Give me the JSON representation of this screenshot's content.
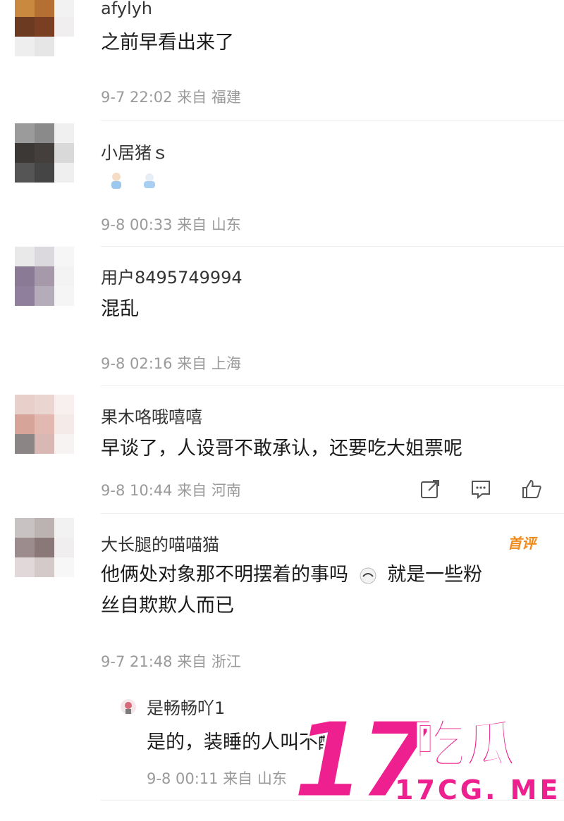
{
  "comments": [
    {
      "username": "afylyh",
      "text": "之前早看出来了",
      "time": "9-7 22:02",
      "from_label": "来自",
      "location": "福建",
      "avatar_colors": [
        "#c98a3f",
        "#b56f33",
        "#f2f2f2",
        "#6b3a20",
        "#7a3f22",
        "#f0eeee",
        "#eeeeee",
        "#e6e6e6",
        "#ffffff"
      ]
    },
    {
      "username": "小居猪ｓ",
      "text": "",
      "emoji": [
        "baby-emoji-icon",
        "baby-emoji-icon"
      ],
      "time": "9-8 00:33",
      "from_label": "来自",
      "location": "山东",
      "avatar_colors": [
        "#9b9b9b",
        "#8a8a8a",
        "#f0f0f0",
        "#3c3835",
        "#443f3c",
        "#d9d9d9",
        "#555555",
        "#454545",
        "#efefef"
      ]
    },
    {
      "username": "用户8495749994",
      "text": "混乱",
      "time": "9-8 02:16",
      "from_label": "来自",
      "location": "上海",
      "avatar_colors": [
        "#e9e9ea",
        "#dcd9de",
        "#f6f6f6",
        "#8a7a96",
        "#a69aaa",
        "#f3f3f3",
        "#8f7f9c",
        "#b5acb9",
        "#f5f5f5"
      ]
    },
    {
      "username": "果木咯哦嘻嘻",
      "text": "早谈了，人设哥不敢承认，还要吃大姐票呢",
      "time": "9-8 10:44",
      "from_label": "来自",
      "location": "河南",
      "avatar_colors": [
        "#e8cfc9",
        "#ead5d1",
        "#f8f0ef",
        "#d7a49a",
        "#e2b9b0",
        "#f4ebe9",
        "#8b8585",
        "#d9b7b3",
        "#f6f3f2"
      ]
    },
    {
      "username": "大长腿的喵喵猫",
      "badge": "首评",
      "text_line1": "他俩处对象那不明摆着的事吗",
      "text_line2_after_emoji": "就是一些粉",
      "text_line3": "丝自欺欺人而已",
      "time": "9-7 21:48",
      "from_label": "来自",
      "location": "浙江",
      "avatar_colors": [
        "#c9c2c2",
        "#bcb2b2",
        "#f2f2f2",
        "#9d8c8e",
        "#8a7879",
        "#f0eeee",
        "#e1d9d9",
        "#d4caca",
        "#f7f7f7"
      ]
    }
  ],
  "reply": {
    "username": "是畅畅吖1",
    "text": "是的，装睡的人叫不醒",
    "time": "9-8 00:11",
    "from_label": "来自",
    "location": "山东"
  },
  "watermark": {
    "big": "17",
    "cn": "吃瓜",
    "url": "17CG. ME"
  },
  "colors": {
    "watermark": "#ee1f8f",
    "badge": "#f08a1c",
    "meta": "#9a9a9a"
  }
}
